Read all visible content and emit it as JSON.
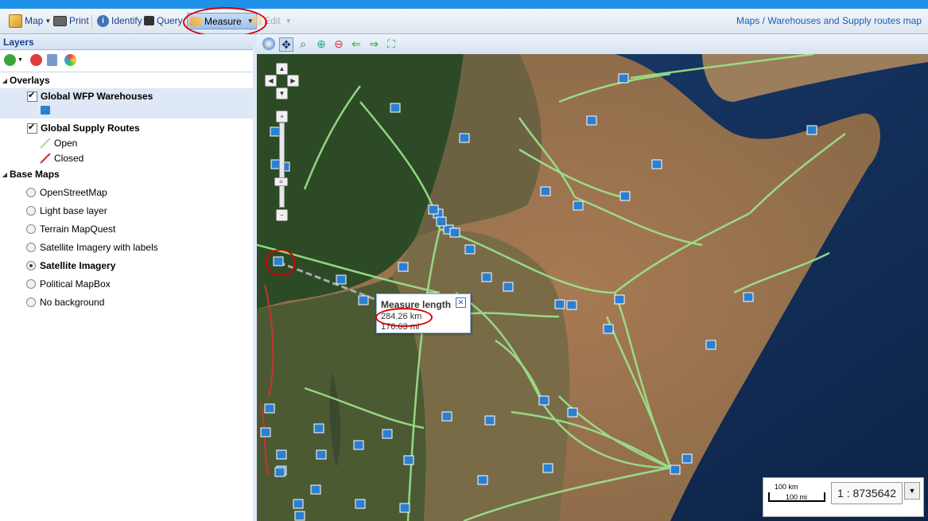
{
  "toolbar": {
    "map": "Map",
    "print": "Print",
    "identify": "Identify",
    "query": "Query",
    "measure": "Measure",
    "edit": "Edit",
    "breadcrumb": "Maps / Warehouses and Supply routes map"
  },
  "layers": {
    "title": "Layers",
    "overlays_label": "Overlays",
    "overlay_warehouses": "Global WFP Warehouses",
    "overlay_routes": "Global Supply Routes",
    "legend_open": "Open",
    "legend_closed": "Closed",
    "base_maps_label": "Base Maps",
    "base_maps": [
      "OpenStreetMap",
      "Light base layer",
      "Terrain MapQuest",
      "Satellite Imagery with labels",
      "Satellite Imagery",
      "Political MapBox",
      "No background"
    ],
    "selected_base": "Satellite Imagery"
  },
  "measure_popup": {
    "title": "Measure length",
    "km": "284.26 km",
    "mi": "176.63 mi"
  },
  "scale": {
    "km_label": "100 km",
    "mi_label": "100 mi",
    "ratio": "1 : 8735642"
  },
  "colors": {
    "route_open": "#9be68c",
    "route_closed": "#c83232",
    "accent": "#15428b",
    "highlight": "#d40000"
  }
}
